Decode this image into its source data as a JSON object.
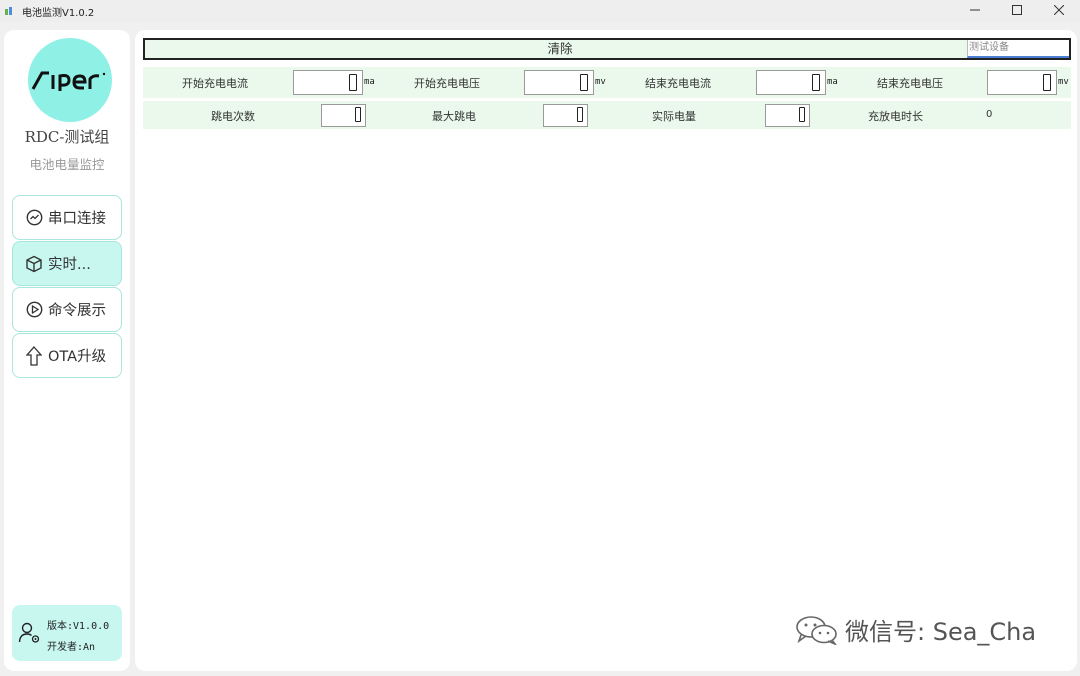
{
  "window": {
    "title": "电池监测V1.0.2",
    "minimize_icon": "minimize-icon",
    "maximize_icon": "maximize-icon",
    "close_icon": "close-icon"
  },
  "sidebar": {
    "logo_text": "AIPEr",
    "group_name": "RDC-测试组",
    "subtitle": "电池电量监控",
    "nav": [
      {
        "label": "串口连接",
        "icon": "chart-circle-icon",
        "active": false
      },
      {
        "label": "实时...",
        "icon": "cube-icon",
        "active": true
      },
      {
        "label": "命令展示",
        "icon": "play-circle-icon",
        "active": false
      },
      {
        "label": "OTA升级",
        "icon": "upload-arrow-icon",
        "active": false
      }
    ],
    "info": {
      "version": "版本:V1.0.0",
      "developer": "开发者:An",
      "icon": "user-settings-icon"
    }
  },
  "main": {
    "clear_label": "清除",
    "device_field": "测试设备",
    "row1": [
      {
        "label": "开始充电电流",
        "value": "0",
        "unit": "ma"
      },
      {
        "label": "开始充电电压",
        "value": "0",
        "unit": "mv"
      },
      {
        "label": "结束充电电流",
        "value": "0",
        "unit": "ma"
      },
      {
        "label": "结束充电电压",
        "value": "0",
        "unit": "mv"
      }
    ],
    "row2": [
      {
        "label": "跳电次数",
        "value": "0"
      },
      {
        "label": "最大跳电",
        "value": "0"
      },
      {
        "label": "实际电量",
        "value": "0"
      },
      {
        "label": "充放电时长",
        "value": "0"
      }
    ]
  },
  "watermark": {
    "text": "微信号: Sea_Cha",
    "icon": "wechat-icon"
  },
  "colors": {
    "accent": "#8ff0e6",
    "active_nav": "#c8f7f0",
    "panel_row": "#eaf9ec"
  }
}
